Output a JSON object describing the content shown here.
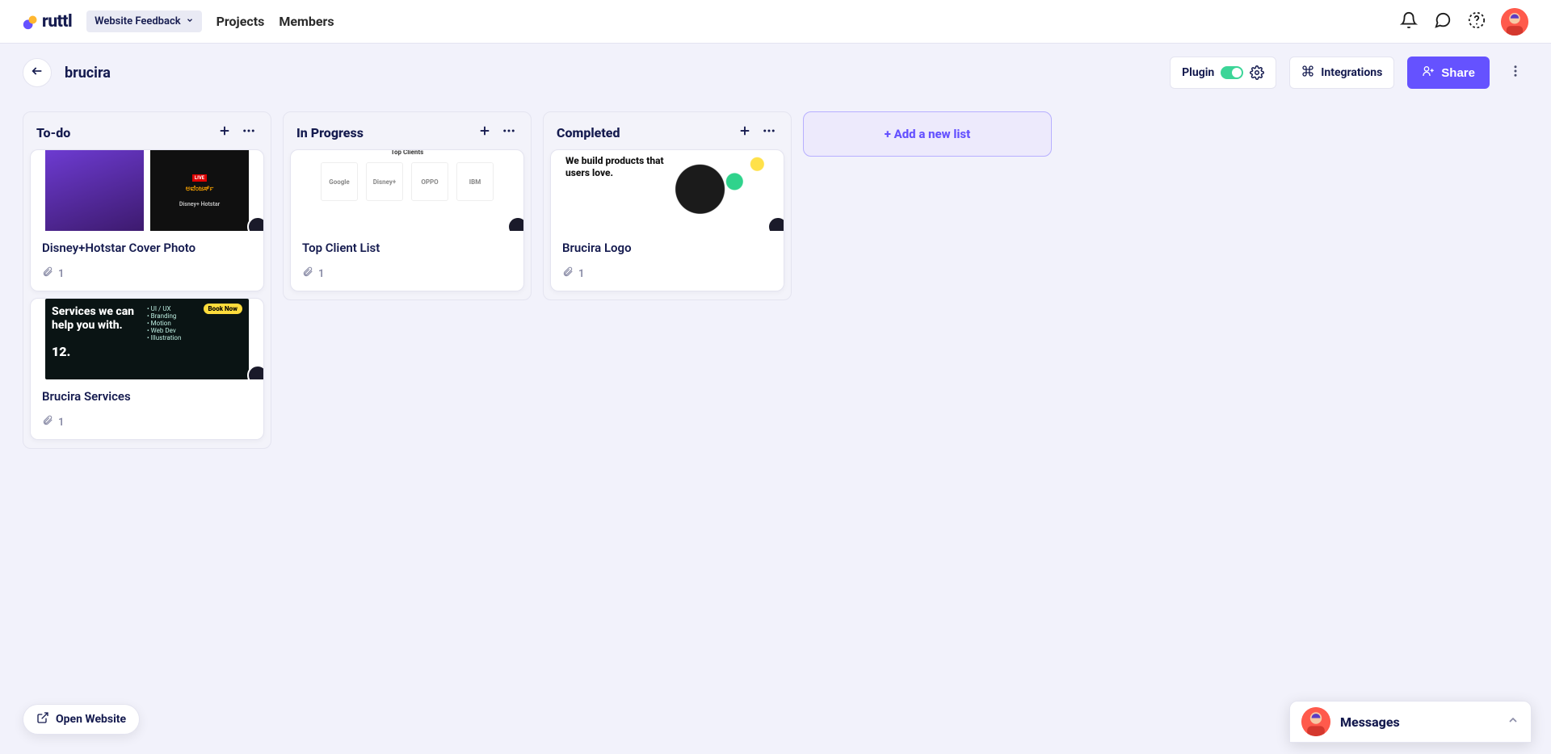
{
  "brand": {
    "name": "ruttl"
  },
  "topnav": {
    "dropdown_label": "Website Feedback",
    "links": {
      "projects": "Projects",
      "members": "Members"
    }
  },
  "toolbar": {
    "project_name": "brucira",
    "plugin_label": "Plugin",
    "plugin_enabled": true,
    "integrations_label": "Integrations",
    "share_label": "Share"
  },
  "board": {
    "lists": [
      {
        "title": "To-do",
        "cards": [
          {
            "title": "Disney+Hotstar Cover Photo",
            "attachments": 1,
            "thumb": "hotstar"
          },
          {
            "title": "Brucira Services",
            "attachments": 1,
            "thumb": "services"
          }
        ]
      },
      {
        "title": "In Progress",
        "cards": [
          {
            "title": "Top Client List",
            "attachments": 1,
            "thumb": "clients"
          }
        ]
      },
      {
        "title": "Completed",
        "cards": [
          {
            "title": "Brucira Logo",
            "attachments": 1,
            "thumb": "brucira"
          }
        ]
      }
    ],
    "add_list_label": "+ Add a new list"
  },
  "floating": {
    "open_website": "Open Website",
    "messages": "Messages"
  },
  "thumb_text": {
    "hotstar_caption": "Disney+ Hotstar",
    "clients_header": "Top Clients",
    "clients_logos": [
      "Google",
      "Disney+",
      "OPPO",
      "IBM"
    ],
    "brucira_headline": "We build products that users love.",
    "services_headline": "Services we can help you with.",
    "services_num": "12.",
    "services_pill": "Book Now"
  }
}
